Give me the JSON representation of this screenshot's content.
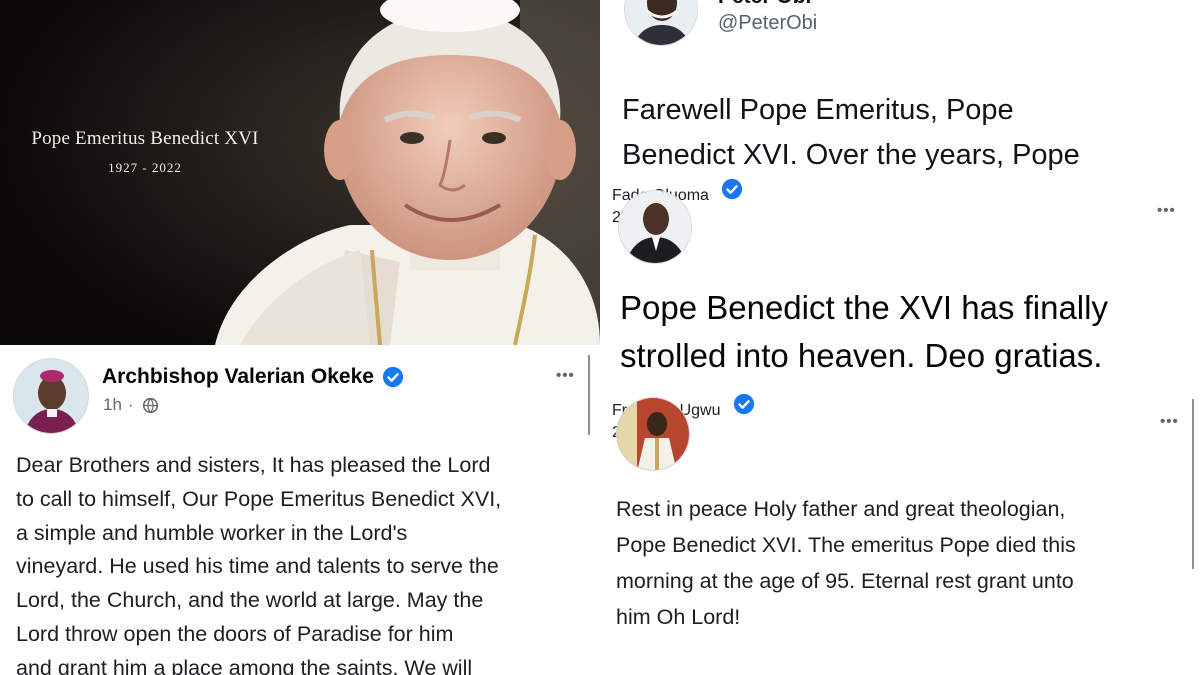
{
  "photo": {
    "caption_name": "Pope Emeritus Benedict XVI",
    "caption_years": "1927 - 2022"
  },
  "tweet": {
    "author_partial": "Peter Obi",
    "handle": "@PeterObi",
    "text_line1": "Farewell Pope Emeritus, Pope",
    "text_line2": "Benedict XVI. Over the years, Pope"
  },
  "post_okeke": {
    "author": "Archbishop Valerian Okeke",
    "time": "1h",
    "more": "•••",
    "lines": [
      "Dear Brothers and sisters, It has pleased the Lord",
      "to call to himself, Our Pope Emeritus Benedict XVI,",
      "a simple and humble worker in the Lord's",
      "vineyard. He used his time and talents to serve the",
      "Lord, the Church, and the world at large. May the",
      "Lord throw open the doors of Paradise for him",
      "and grant him a place among the saints. We will"
    ]
  },
  "post_fada": {
    "author": "Fada Oluoma",
    "time": "2h",
    "more": "•••",
    "line1": "Pope Benedict the XVI has finally",
    "line2": "strolled into heaven. Deo gratias."
  },
  "post_kelvin": {
    "author": "Fr Kelvin Ugwu",
    "time": "2h",
    "more": "•••",
    "lines": [
      "Rest in peace Holy father and great theologian,",
      "Pope Benedict XVI. The emeritus Pope died this",
      "morning at the age of 95. Eternal rest grant unto",
      "him Oh Lord!"
    ]
  },
  "colors": {
    "verified_blue": "#1877f2",
    "meta_gray": "#65676b",
    "text_dark": "#1c1e21"
  },
  "icons": [
    "verified-badge-icon",
    "globe-icon",
    "more-options-icon"
  ]
}
